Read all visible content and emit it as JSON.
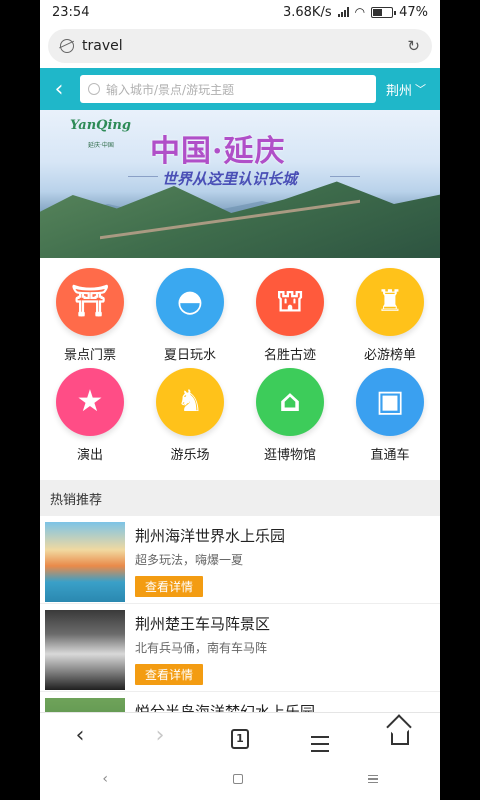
{
  "status_bar": {
    "time": "23:54",
    "speed": "3.68K/s",
    "battery": "47%"
  },
  "browser": {
    "url_text": "travel"
  },
  "header": {
    "search_placeholder": "输入城市/景点/游玩主题",
    "city": "荆州"
  },
  "banner": {
    "logo": "YanQing",
    "logo_sub": "延庆·中国",
    "title": "中国·延庆",
    "slogan": "世界从这里认识长城"
  },
  "categories": [
    {
      "label": "景点门票",
      "icon": "pavilion-icon",
      "glyph": "⛩",
      "color": "#ff6b4a"
    },
    {
      "label": "夏日玩水",
      "icon": "diving-mask-icon",
      "glyph": "◓",
      "color": "#3aa8f0"
    },
    {
      "label": "名胜古迹",
      "icon": "gate-tower-icon",
      "glyph": "⛫",
      "color": "#ff5a3c"
    },
    {
      "label": "必游榜单",
      "icon": "castle-icon",
      "glyph": "♜",
      "color": "#ffc21a"
    },
    {
      "label": "演出",
      "icon": "stage-star-icon",
      "glyph": "★",
      "color": "#ff4d86"
    },
    {
      "label": "游乐场",
      "icon": "carousel-icon",
      "glyph": "♞",
      "color": "#ffc21a"
    },
    {
      "label": "逛博物馆",
      "icon": "museum-icon",
      "glyph": "⌂",
      "color": "#3dcc5a"
    },
    {
      "label": "直通车",
      "icon": "bus-icon",
      "glyph": "▣",
      "color": "#3aa0f0"
    }
  ],
  "section_title": "热销推荐",
  "list": [
    {
      "name": "荆州海洋世界水上乐园",
      "desc": "超多玩法，嗨爆一夏",
      "button": "查看详情"
    },
    {
      "name": "荆州楚王车马阵景区",
      "desc": "北有兵马俑，南有车马阵",
      "button": "查看详情"
    },
    {
      "name": "悦兮半岛海洋梦幻水上乐园",
      "desc": "",
      "button": ""
    }
  ],
  "toolbar": {
    "tab_count": "1"
  },
  "colors": {
    "header_bg": "#1fb7c9",
    "button_orange": "#f39c12"
  }
}
